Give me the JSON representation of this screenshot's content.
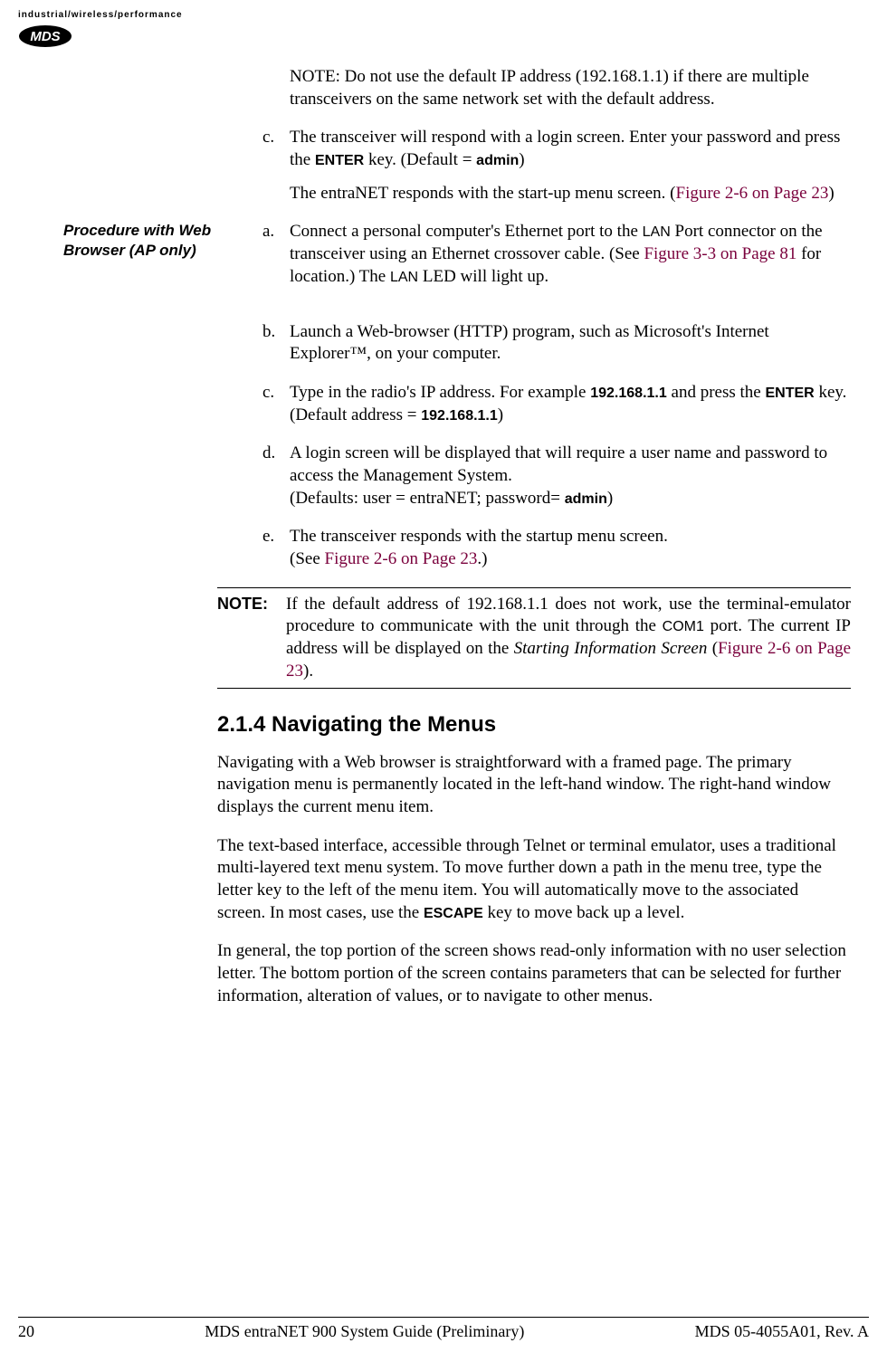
{
  "header": {
    "tagline": "industrial/wireless/performance",
    "logo_text": "MDS"
  },
  "intro_note": "NOTE: Do not use the default IP address (192.168.1.1) if there are multiple transceivers on the same network set with the default address.",
  "item_c": {
    "marker": "c.",
    "text_before_enter": "The transceiver will respond with a login screen. Enter your password and press the ",
    "enter": "ENTER",
    "text_after_enter": " key. (Default = ",
    "admin": "admin",
    "close": ")",
    "sub_before_ref": "The entraNET responds with the start-up menu screen. (",
    "ref": "Figure 2-6 on Page 23",
    "sub_after_ref": ")"
  },
  "procedure_label": "Procedure with Web Browser (AP only)",
  "proc_a": {
    "marker": "a.",
    "t1": "Connect a personal computer's Ethernet port to the ",
    "lan1": "LAN",
    "t2": " Port connector on the transceiver using an Ethernet crossover cable. (See ",
    "ref": "Figure 3-3 on Page 81",
    "t3": " for location.) The ",
    "lan2": "LAN",
    "t4": " LED will light up."
  },
  "proc_b": {
    "marker": "b.",
    "text": "Launch a Web-browser (HTTP) program, such as Microsoft's Internet Explorer™, on your computer."
  },
  "proc_c": {
    "marker": "c.",
    "t1": "Type in the radio's IP address. For example ",
    "ip1": "192.168.1.1",
    "t2": " and press the ",
    "enter": "ENTER",
    "t3": " key. (Default address = ",
    "ip2": "192.168.1.1",
    "t4": ")"
  },
  "proc_d": {
    "marker": "d.",
    "t1": "A login screen will be displayed that will require a user name and password to access the Management System.",
    "t2_before": "(Defaults: user = entraNET; password= ",
    "admin": "admin",
    "t2_after": ")"
  },
  "proc_e": {
    "marker": "e.",
    "t1": "The transceiver responds with the startup menu screen.",
    "t2_before": "(See ",
    "ref": "Figure 2-6 on Page 23",
    "t2_after": ".)"
  },
  "note": {
    "label": "NOTE:",
    "t1": "If the default address of 192.168.1.1 does not work, use the terminal-emulator procedure to communicate with the unit through the ",
    "com1": "COM1",
    "t2": " port. The current IP address will be displayed on the ",
    "screen_name": "Starting Information Screen",
    "t3_before": " (",
    "ref": "Figure 2-6 on Page 23",
    "t3_after": ")."
  },
  "section": {
    "heading": "2.1.4 Navigating the Menus",
    "p1": "Navigating with a Web browser is straightforward with a framed page. The primary navigation menu is permanently located in the left-hand window. The right-hand window displays the current menu item.",
    "p2_before": "The text-based interface, accessible through Telnet or terminal emulator, uses a traditional multi-layered text menu system. To move further down a path in the menu tree, type the letter key to the left of the menu item. You will automatically move to the associated screen. In most cases, use the ",
    "escape": "ESCAPE",
    "p2_after": " key to move back up a level.",
    "p3": "In general, the top portion of the screen shows read-only information with no user selection letter. The bottom portion of the screen contains parameters that can be selected for further information, alteration of values, or to navigate to other menus."
  },
  "footer": {
    "page_num": "20",
    "title": "MDS entraNET 900 System Guide (Preliminary)",
    "doc_id": "MDS 05-4055A01, Rev. A"
  }
}
